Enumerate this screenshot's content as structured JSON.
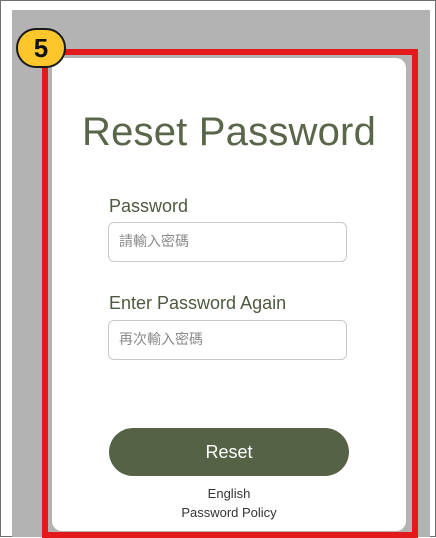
{
  "step_number": "5",
  "form": {
    "title": "Reset Password",
    "password": {
      "label": "Password",
      "value": "",
      "placeholder": "請輸入密碼"
    },
    "password_again": {
      "label": "Enter Password Again",
      "value": "",
      "placeholder": "再次輸入密碼"
    },
    "reset_button_label": "Reset"
  },
  "footer": {
    "language_link": "English",
    "policy_link": "Password Policy"
  },
  "colors": {
    "accent": "#566246",
    "title": "#5a6649",
    "highlight_border": "#e3191c",
    "badge": "#fdc62a",
    "backdrop": "#b3b3b3"
  }
}
